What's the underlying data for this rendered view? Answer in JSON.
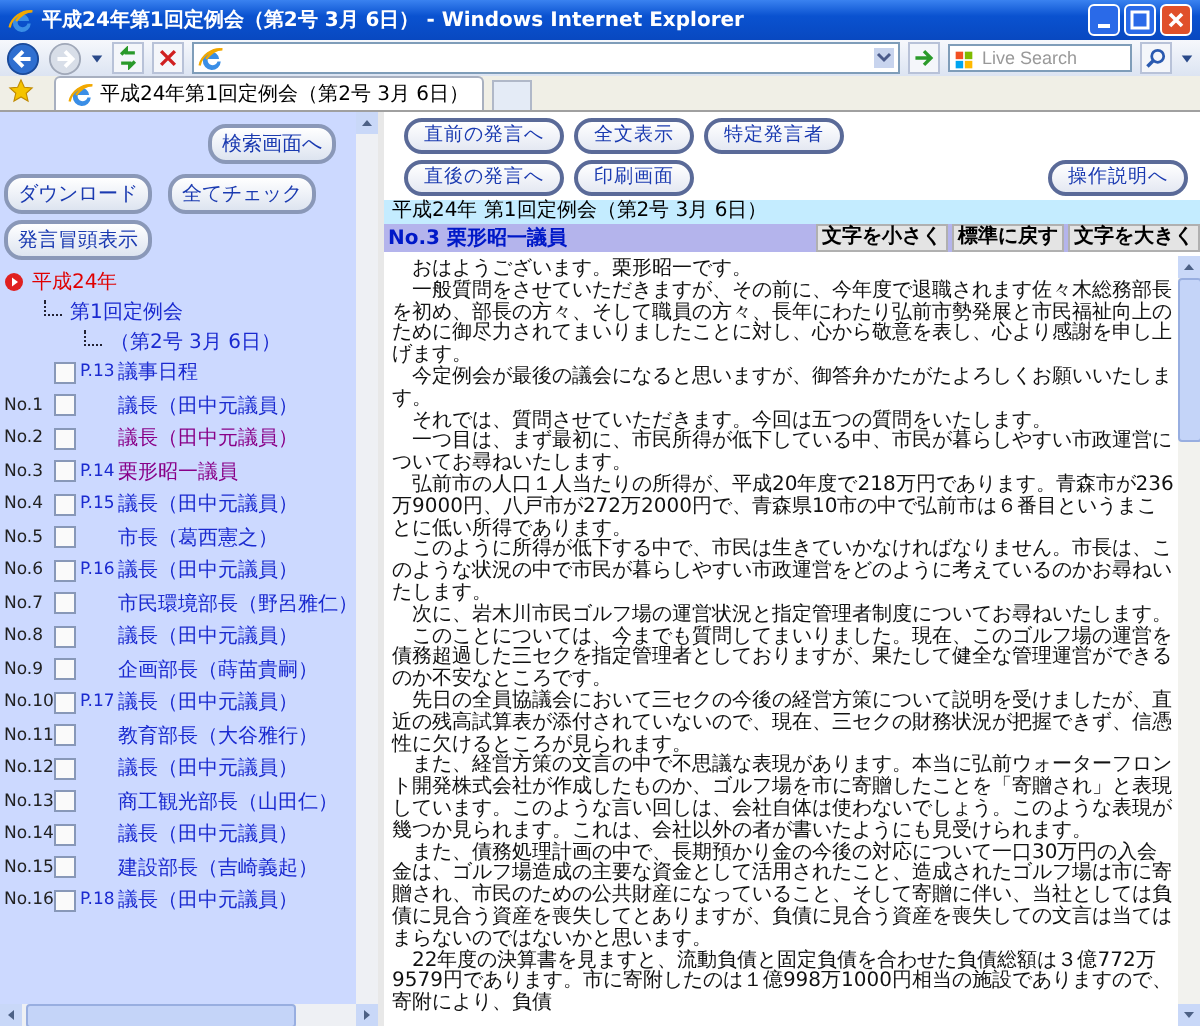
{
  "window": {
    "title": "平成24年第1回定例会（第2号 3月 6日） - Windows Internet Explorer"
  },
  "toolbar": {
    "search": {
      "placeholder": "Live Search"
    }
  },
  "tabs": [
    {
      "label": "平成24年第1回定例会（第2号 3月 6日）",
      "selected": true
    }
  ],
  "left": {
    "search_button": "検索画面へ",
    "buttons": [
      "ダウンロード",
      "全てチェック",
      "発言冒頭表示"
    ],
    "tree": {
      "label": "平成24年",
      "children": [
        {
          "label": "第1回定例会",
          "children": [
            {
              "label": "（第2号 3月 6日）"
            }
          ]
        }
      ]
    },
    "speeches": [
      {
        "page": "P.13",
        "speaker": "議事日程",
        "checked": false,
        "visited": false
      },
      {
        "number": "No.1",
        "speaker": "議長（田中元議員）",
        "checked": false,
        "visited": false
      },
      {
        "number": "No.2",
        "speaker": "議長（田中元議員）",
        "checked": false,
        "visited": true
      },
      {
        "number": "No.3",
        "page": "P.14",
        "speaker": "栗形昭一議員",
        "checked": false,
        "visited": true
      },
      {
        "number": "No.4",
        "page": "P.15",
        "speaker": "議長（田中元議員）",
        "checked": false,
        "visited": false
      },
      {
        "number": "No.5",
        "speaker": "市長（葛西憲之）",
        "checked": false,
        "visited": false
      },
      {
        "number": "No.6",
        "page": "P.16",
        "speaker": "議長（田中元議員）",
        "checked": false,
        "visited": false
      },
      {
        "number": "No.7",
        "speaker": "市民環境部長（野呂雅仁）",
        "checked": false,
        "visited": false
      },
      {
        "number": "No.8",
        "speaker": "議長（田中元議員）",
        "checked": false,
        "visited": false
      },
      {
        "number": "No.9",
        "speaker": "企画部長（蒔苗貴嗣）",
        "checked": false,
        "visited": false
      },
      {
        "number": "No.10",
        "page": "P.17",
        "speaker": "議長（田中元議員）",
        "checked": false,
        "visited": false
      },
      {
        "number": "No.11",
        "speaker": "教育部長（大谷雅行）",
        "checked": false,
        "visited": false
      },
      {
        "number": "No.12",
        "speaker": "議長（田中元議員）",
        "checked": false,
        "visited": false
      },
      {
        "number": "No.13",
        "speaker": "商工観光部長（山田仁）",
        "checked": false,
        "visited": false
      },
      {
        "number": "No.14",
        "speaker": "議長（田中元議員）",
        "checked": false,
        "visited": false
      },
      {
        "number": "No.15",
        "speaker": "建設部長（吉崎義起）",
        "checked": false,
        "visited": false
      },
      {
        "number": "No.16",
        "page": "P.18",
        "speaker": "議長（田中元議員）",
        "checked": false,
        "visited": false
      }
    ]
  },
  "right": {
    "nav_rows": [
      [
        "直前の発言へ",
        "全文表示",
        "特定発言者"
      ],
      [
        "直後の発言へ",
        "印刷画面"
      ]
    ],
    "help_button": "操作説明へ",
    "header": "平成24年 第1回定例会（第2号 3月 6日）",
    "speaker_title": "No.3 栗形昭一議員",
    "font_buttons": [
      "文字を小さく",
      "標準に戻す",
      "文字を大きく"
    ],
    "paragraphs": [
      "おはようございます。栗形昭一です。",
      "一般質問をさせていただきますが、その前に、今年度で退職されます佐々木総務部長を初め、部長の方々、そして職員の方々、長年にわたり弘前市勢発展と市民福祉向上のために御尽力されてまいりましたことに対し、心から敬意を表し、心より感謝を申し上げます。",
      "今定例会が最後の議会になると思いますが、御答弁かたがたよろしくお願いいたします。",
      "それでは、質問させていただきます。今回は五つの質問をいたします。",
      "一つ目は、まず最初に、市民所得が低下している中、市民が暮らしやすい市政運営についてお尋ねいたします。",
      "弘前市の人口１人当たりの所得が、平成20年度で218万円であります。青森市が236万9000円、八戸市が272万2000円で、青森県10市の中で弘前市は６番目というまことに低い所得であります。",
      "このように所得が低下する中で、市民は生きていかなければなりません。市長は、このような状況の中で市民が暮らしやすい市政運営をどのように考えているのかお尋ねいたします。",
      "次に、岩木川市民ゴルフ場の運営状況と指定管理者制度についてお尋ねいたします。",
      "このことについては、今までも質問してまいりました。現在、このゴルフ場の運営を債務超過した三セクを指定管理者としておりますが、果たして健全な管理運営ができるのか不安なところです。",
      "先日の全員協議会において三セクの今後の経営方策について説明を受けましたが、直近の残高試算表が添付されていないので、現在、三セクの財務状況が把握できず、信憑性に欠けるところが見られます。",
      "また、経営方策の文言の中で不思議な表現があります。本当に弘前ウォーターフロント開発株式会社が作成したものか、ゴルフ場を市に寄贈したことを「寄贈され」と表現しています。このような言い回しは、会社自体は使わないでしょう。このような表現が幾つか見られます。これは、会社以外の者が書いたようにも見受けられます。",
      "また、債務処理計画の中で、長期預かり金の今後の対応について一口30万円の入会金は、ゴルフ場造成の主要な資金として活用されたこと、造成されたゴルフ場は市に寄贈され、市民のための公共財産になっていること、そして寄贈に伴い、当社としては負債に見合う資産を喪失してとありますが、負債に見合う資産を喪失しての文言は当てはまらないのではないかと思います。",
      "22年度の決算書を見ますと、流動負債と固定負債を合わせた負債総額は３億772万9579円であります。市に寄附したのは１億998万1000円相当の施設でありますので、寄附により、負債"
    ]
  }
}
